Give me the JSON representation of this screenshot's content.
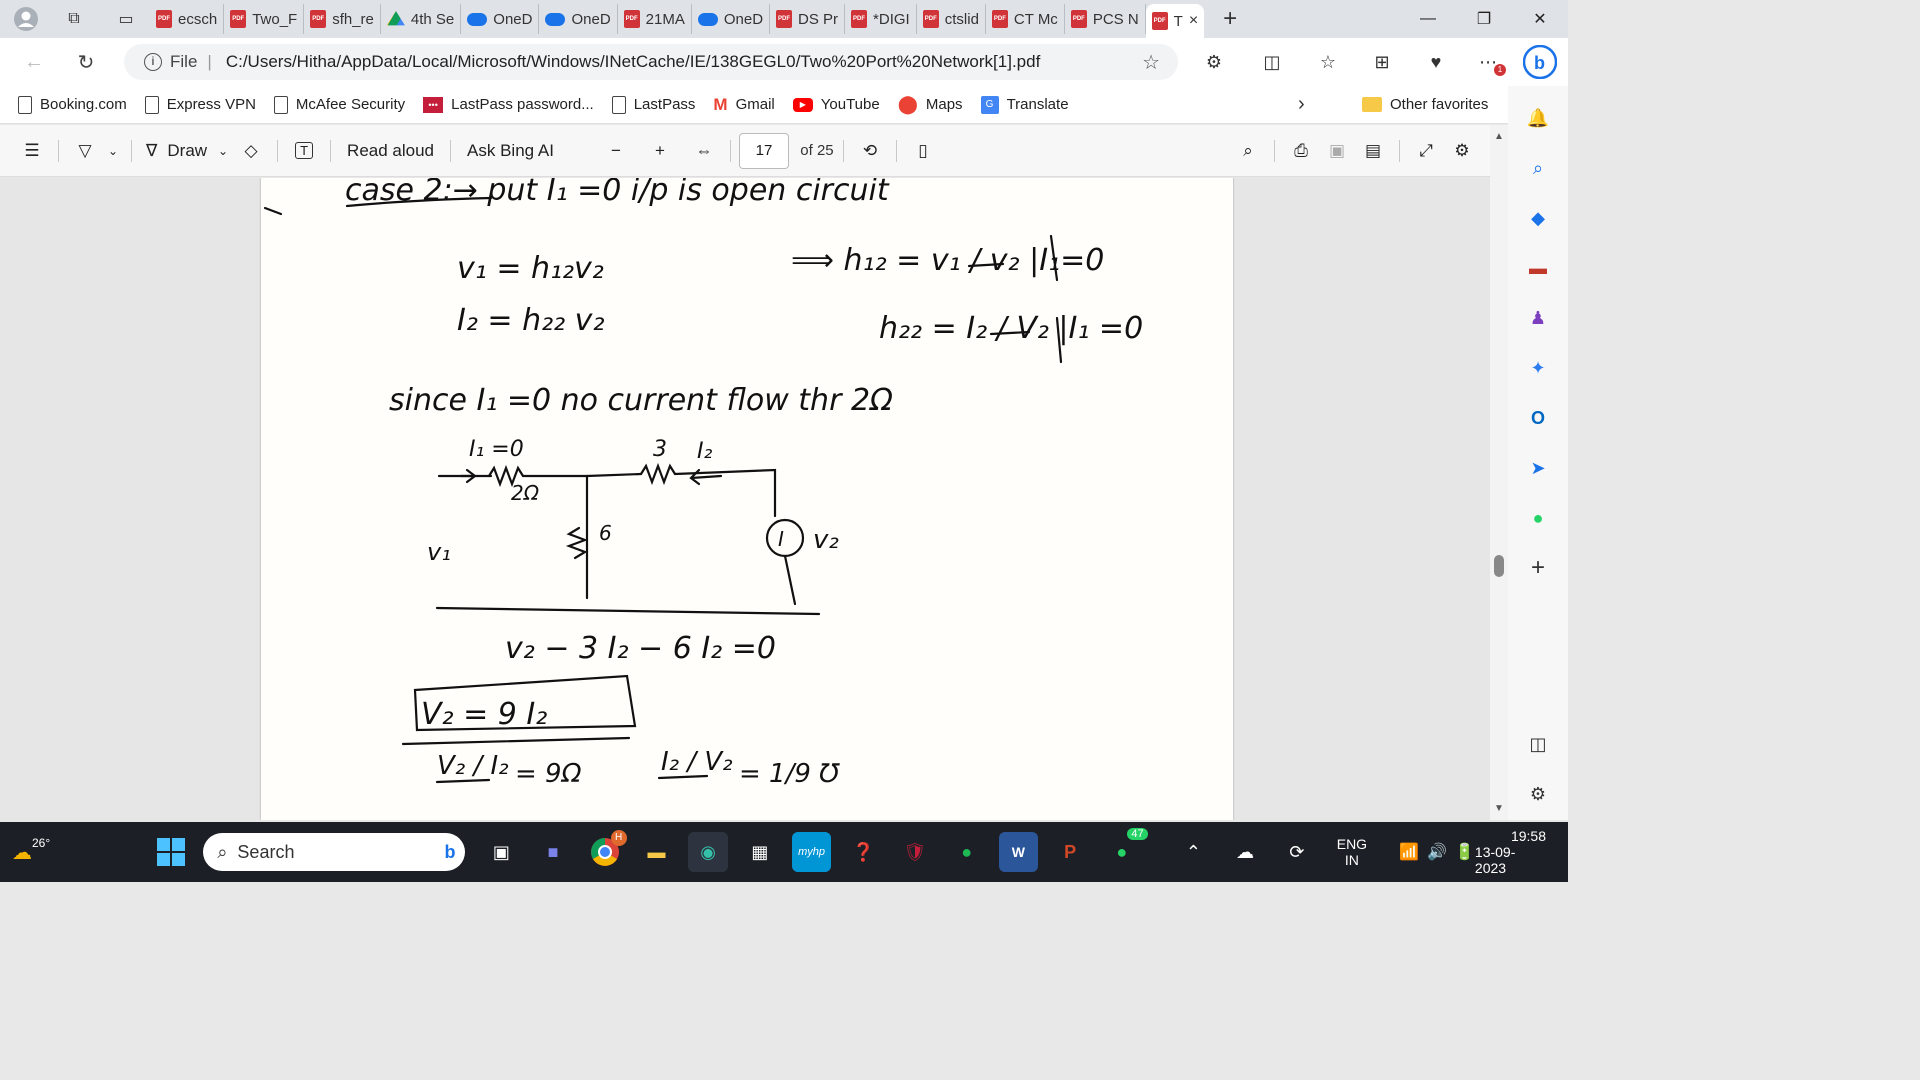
{
  "tabs": [
    {
      "label": "ecsch",
      "icon": "pdf"
    },
    {
      "label": "Two_F",
      "icon": "pdf"
    },
    {
      "label": "sfh_re",
      "icon": "pdf"
    },
    {
      "label": "4th Se",
      "icon": "drive"
    },
    {
      "label": "OneD",
      "icon": "cloud"
    },
    {
      "label": "OneD",
      "icon": "cloud"
    },
    {
      "label": "21MA",
      "icon": "pdf"
    },
    {
      "label": "OneD",
      "icon": "cloud"
    },
    {
      "label": "DS Pr",
      "icon": "pdf"
    },
    {
      "label": "*DIGI",
      "icon": "pdf"
    },
    {
      "label": "ctslid",
      "icon": "pdf"
    },
    {
      "label": "CT Mc",
      "icon": "pdf"
    },
    {
      "label": "PCS N",
      "icon": "pdf"
    }
  ],
  "active_tab": {
    "label": "T",
    "close": "×"
  },
  "new_tab": "+",
  "window": {
    "minimize": "—",
    "restore": "❐",
    "close": "✕"
  },
  "address": {
    "scheme": "File",
    "url": "C:/Users/Hitha/AppData/Local/Microsoft/Windows/INetCache/IE/138GEGL0/Two%20Port%20Network[1].pdf"
  },
  "favorites": [
    "Booking.com",
    "Express VPN",
    "McAfee Security",
    "LastPass password...",
    "LastPass",
    "Gmail",
    "YouTube",
    "Maps",
    "Translate"
  ],
  "other_favorites": "Other favorites",
  "pdf_toolbar": {
    "draw": "Draw",
    "read_aloud": "Read aloud",
    "ask_bing": "Ask Bing AI",
    "page_number": "17",
    "page_total": "of 25"
  },
  "handwriting": {
    "line1": "case 2:→ put I₁ =0      i/p is open circuit",
    "v1": "v₁  = h₁₂v₂",
    "h12": "⟹  h₁₂ = v₁ / v₂ |I₁=0",
    "i2": "I₂   = h₂₂ v₂",
    "h22": "h₂₂ =  I₂ / V₂ |I₁ =0",
    "since": "since  I₁ =0    no current  flow thr  2Ω",
    "i1zero": "I₁ =0",
    "r1": "2Ω",
    "r2": "3",
    "i2label": "I₂",
    "v1node": "v₁",
    "r6": "6",
    "src": "I",
    "v2node": "v₂",
    "eq1": "v₂ − 3 I₂ − 6 I₂ =0",
    "eq2": "V₂ = 9 I₂",
    "eq3a": "V₂ / I₂",
    "eq3b": "= 9Ω",
    "eq3c": "I₂ / V₂",
    "eq3d": "= 1/9 ℧"
  },
  "taskbar": {
    "weather": "26°",
    "search": "Search",
    "lang1": "ENG",
    "lang2": "IN",
    "time": "19:58",
    "date": "13-09-2023",
    "whatsapp_badge": "47",
    "chrome_badge": "H"
  },
  "colors": {
    "accent": "#0067c0",
    "pdf": "#d13438",
    "taskbar": "#1c2026"
  }
}
